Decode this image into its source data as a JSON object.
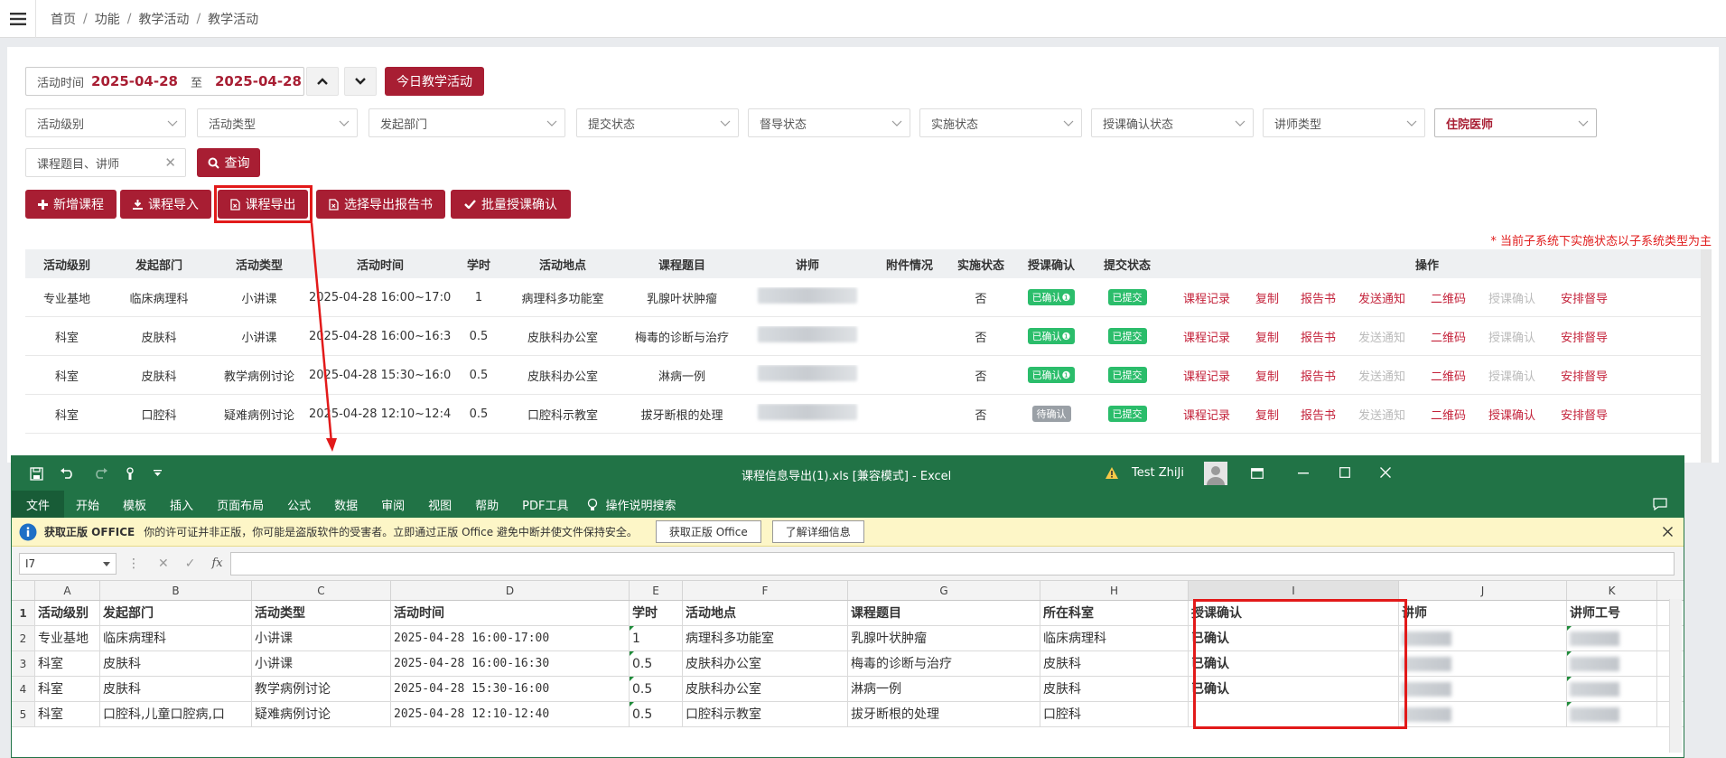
{
  "breadcrumb": [
    "首页",
    "功能",
    "教学活动",
    "教学活动"
  ],
  "filters": {
    "date_label": "活动时间",
    "date_from": "2025-04-28",
    "date_to_sep": "至",
    "date_to": "2025-04-28",
    "today_btn": "今日教学活动",
    "selects": [
      "活动级别",
      "活动类型",
      "发起部门",
      "提交状态",
      "督导状态",
      "实施状态",
      "授课确认状态",
      "讲师类型",
      "住院医师"
    ],
    "keyword_placeholder": "课程题目、讲师",
    "search_btn": "查询"
  },
  "actions": [
    "新增课程",
    "课程导入",
    "课程导出",
    "选择导出报告书",
    "批量授课确认"
  ],
  "note": "* 当前子系统下实施状态以子系统类型为主",
  "table": {
    "headers": [
      "活动级别",
      "发起部门",
      "活动类型",
      "活动时间",
      "学时",
      "活动地点",
      "课程题目",
      "讲师",
      "附件情况",
      "实施状态",
      "授课确认",
      "提交状态",
      "操作"
    ],
    "rows": [
      {
        "level": "专业基地",
        "dept": "临床病理科",
        "type": "小讲课",
        "time": "2025-04-28  16:00~17:00",
        "hours": "1",
        "place": "病理科多功能室",
        "topic": "乳腺叶状肿瘤",
        "impl": "否",
        "confirm": "已确认❶",
        "submit": "已提交"
      },
      {
        "level": "科室",
        "dept": "皮肤科",
        "type": "小讲课",
        "time": "2025-04-28  16:00~16:30",
        "hours": "0.5",
        "place": "皮肤科办公室",
        "topic": "梅毒的诊断与治疗",
        "impl": "否",
        "confirm": "已确认❶",
        "submit": "已提交"
      },
      {
        "level": "科室",
        "dept": "皮肤科",
        "type": "教学病例讨论",
        "time": "2025-04-28  15:30~16:00",
        "hours": "0.5",
        "place": "皮肤科办公室",
        "topic": "淋病一例",
        "impl": "否",
        "confirm": "已确认❶",
        "submit": "已提交"
      },
      {
        "level": "科室",
        "dept": "口腔科",
        "type": "疑难病例讨论",
        "time": "2025-04-28  12:10~12:40",
        "hours": "0.5",
        "place": "口腔科示教室",
        "topic": "拔牙断根的处理",
        "impl": "否",
        "confirm": "待确认",
        "submit": "已提交"
      }
    ],
    "ops": [
      "课程记录",
      "复制",
      "报告书",
      "发送通知",
      "二维码",
      "授课确认",
      "安排督导"
    ]
  },
  "excel": {
    "title": "课程信息导出(1).xls  [兼容模式]  -  Excel",
    "user": "Test ZhiJi",
    "menu": [
      "文件",
      "开始",
      "模板",
      "插入",
      "页面布局",
      "公式",
      "数据",
      "审阅",
      "视图",
      "帮助",
      "PDF工具",
      "操作说明搜索"
    ],
    "msg_title": "获取正版 OFFICE",
    "msg_text": "你的许可证并非正版，你可能是盗版软件的受害者。立即通过正版 Office 避免中断并使文件保持安全。",
    "msg_btn1": "获取正版 Office",
    "msg_btn2": "了解详细信息",
    "namebox": "I7",
    "fx": "fx",
    "cols": [
      "A",
      "B",
      "C",
      "D",
      "E",
      "F",
      "G",
      "H",
      "I",
      "J",
      "K"
    ],
    "headers": [
      "活动级别",
      "发起部门",
      "活动类型",
      "活动时间",
      "学时",
      "活动地点",
      "课程题目",
      "所在科室",
      "授课确认",
      "讲师",
      "讲师工号"
    ],
    "rows": [
      [
        "专业基地",
        "临床病理科",
        "小讲课",
        "2025-04-28 16:00-17:00",
        "1",
        "病理科多功能室",
        "乳腺叶状肿瘤",
        "临床病理科",
        "已确认"
      ],
      [
        "科室",
        "皮肤科",
        "小讲课",
        "2025-04-28 16:00-16:30",
        "0.5",
        "皮肤科办公室",
        "梅毒的诊断与治疗",
        "皮肤科",
        "已确认"
      ],
      [
        "科室",
        "皮肤科",
        "教学病例讨论",
        "2025-04-28 15:30-16:00",
        "0.5",
        "皮肤科办公室",
        "淋病一例",
        "皮肤科",
        "已确认"
      ],
      [
        "科室",
        "口腔科,儿童口腔病,口",
        "疑难病例讨论",
        "2025-04-28 12:10-12:40",
        "0.5",
        "口腔科示教室",
        "拔牙断根的处理",
        "口腔科",
        ""
      ]
    ],
    "row_nums": [
      "1",
      "2",
      "3",
      "4",
      "5"
    ]
  }
}
